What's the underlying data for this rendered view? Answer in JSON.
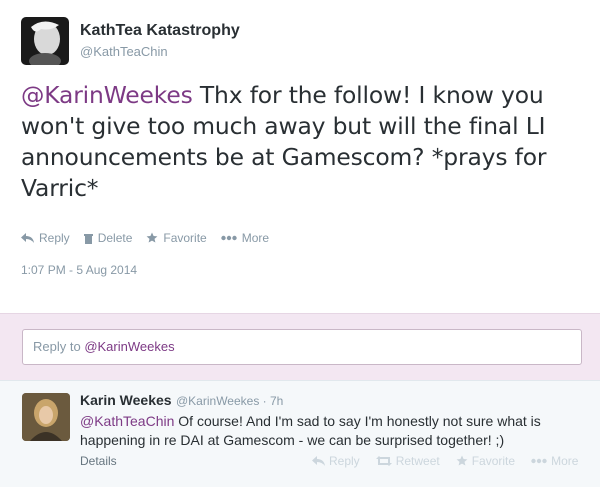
{
  "tweet": {
    "author_name": "KathTea Katastrophy",
    "author_handle": "@KathTeaChin",
    "text_mention": "@KarinWeekes",
    "text_body": " Thx for the follow! I know you won't give too much away but will the final LI announcements be at Gamescom? *prays for Varric*",
    "actions": {
      "reply": "Reply",
      "delete": "Delete",
      "favorite": "Favorite",
      "more": "More"
    },
    "timestamp": "1:07 PM - 5 Aug 2014"
  },
  "reply_box": {
    "prefix": "Reply to ",
    "handle": "@KarinWeekes"
  },
  "reply": {
    "author_name": "Karin Weekes",
    "author_handle": "@KarinWeekes",
    "separator": " · ",
    "time": "7h",
    "text_mention": "@KathTeaChin",
    "text_body": " Of course! And I'm sad to say I'm honestly not sure what is happening in re DAI at Gamescom - we can be surprised together! ;)",
    "details": "Details",
    "actions": {
      "reply": "Reply",
      "retweet": "Retweet",
      "favorite": "Favorite",
      "more": "More"
    }
  },
  "colors": {
    "link": "#7d3a85",
    "muted": "#8899a6",
    "reply_area_bg": "#f3e7f2"
  }
}
